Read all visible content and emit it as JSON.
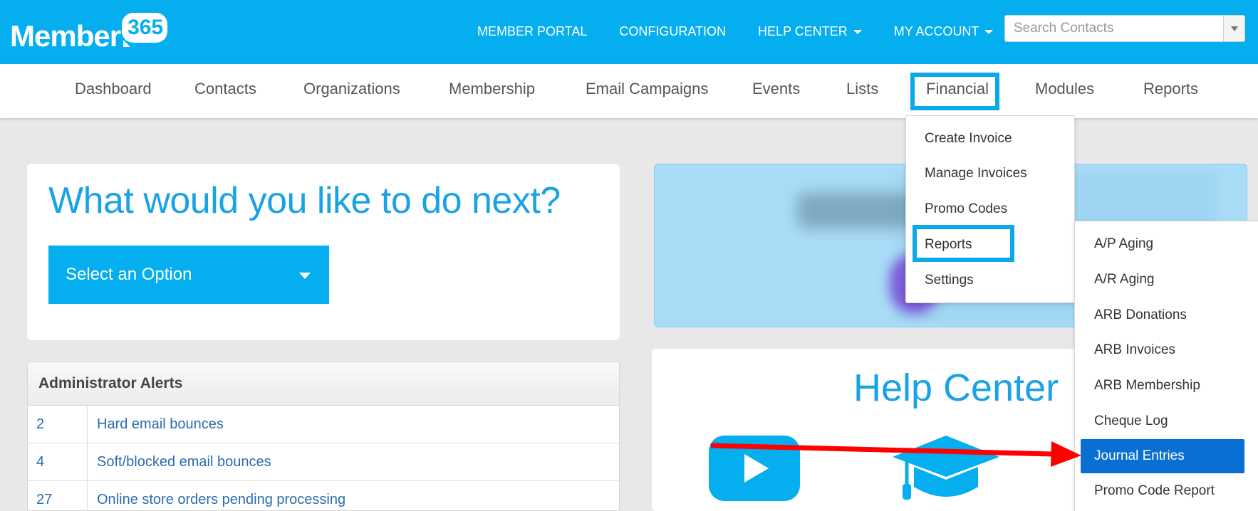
{
  "brand": {
    "logo_word": "Member",
    "logo_badge": "365"
  },
  "topnav": {
    "items": [
      {
        "label": "MEMBER PORTAL",
        "dropdown": false
      },
      {
        "label": "CONFIGURATION",
        "dropdown": false
      },
      {
        "label": "HELP CENTER",
        "dropdown": true
      },
      {
        "label": "MY ACCOUNT",
        "dropdown": true
      }
    ]
  },
  "search": {
    "placeholder": "Search Contacts"
  },
  "mainnav": {
    "items": [
      "Dashboard",
      "Contacts",
      "Organizations",
      "Membership",
      "Email Campaigns",
      "Events",
      "Lists",
      "Financial",
      "Modules",
      "Reports"
    ],
    "highlighted": "Financial"
  },
  "financial_menu": {
    "items": [
      "Create Invoice",
      "Manage Invoices",
      "Promo Codes",
      "Reports",
      "Settings"
    ],
    "highlighted": "Reports"
  },
  "reports_submenu": {
    "items": [
      "A/P Aging",
      "A/R Aging",
      "ARB Donations",
      "ARB Invoices",
      "ARB Membership",
      "Cheque Log",
      "Journal Entries",
      "Promo Code Report"
    ],
    "active": "Journal Entries"
  },
  "next_card": {
    "title": "What would you like to do next?",
    "select_label": "Select an Option"
  },
  "alerts": {
    "title": "Administrator Alerts",
    "rows": [
      {
        "count": "2",
        "text": "Hard email bounces"
      },
      {
        "count": "4",
        "text": "Soft/blocked email bounces"
      },
      {
        "count": "27",
        "text": "Online store orders pending processing"
      }
    ]
  },
  "help_center": {
    "title": "Help Center",
    "icons": [
      "video-play-icon",
      "graduation-cap-icon"
    ]
  },
  "colors": {
    "brand_blue": "#05aeef",
    "active_blue": "#0a6fd3",
    "annotation_red": "#ff0000",
    "highlight_blue": "#0aa9ec"
  }
}
